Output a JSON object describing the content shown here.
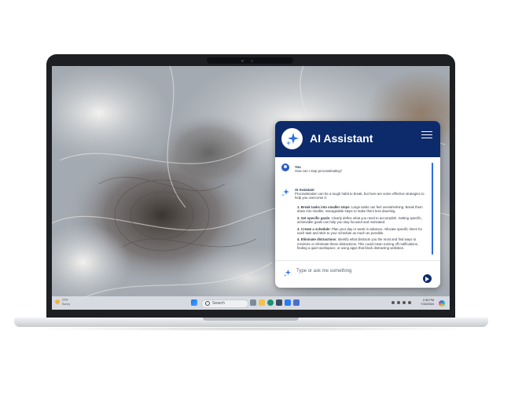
{
  "assistant": {
    "title": "AI Assistant",
    "logo_icon": "sparkle-icon",
    "menu_icon": "hamburger-menu-icon",
    "header_color": "#0d2b6b",
    "user_message": {
      "name": "You",
      "text": "How can I stop procrastinating?"
    },
    "ai_message": {
      "name": "AI Assistant",
      "intro": "Procrastination can be a tough habit to break, but here are some effective strategies to help you overcome it:",
      "tips": [
        {
          "num": "1.",
          "title": "Break tasks into smaller steps",
          "body": ": Large tasks can feel overwhelming. Break them down into smaller, manageable steps to make them less daunting."
        },
        {
          "num": "2.",
          "title": "Set specific goals",
          "body": ": Clearly define what you need to accomplish. Setting specific, achievable goals can help you stay focused and motivated."
        },
        {
          "num": "3.",
          "title": "Create a schedule",
          "body": ": Plan your day or week in advance. Allocate specific times for each task and stick to your schedule as much as possible."
        },
        {
          "num": "4.",
          "title": "Eliminate distractions",
          "body": ": Identify what distracts you the most and find ways to minimize or eliminate these distractions. This could mean turning off notifications, finding a quiet workspace, or using apps that block distracting websites."
        }
      ]
    },
    "input_placeholder": "Type or ask me something",
    "send_icon": "send-icon"
  },
  "taskbar": {
    "weather_temp": "77°F",
    "weather_condition": "Sunny",
    "search_label": "Search",
    "time": "2:30 PM",
    "date": "7/15/2024",
    "start_icon": "windows-start-icon",
    "copilot_icon": "copilot-icon"
  }
}
